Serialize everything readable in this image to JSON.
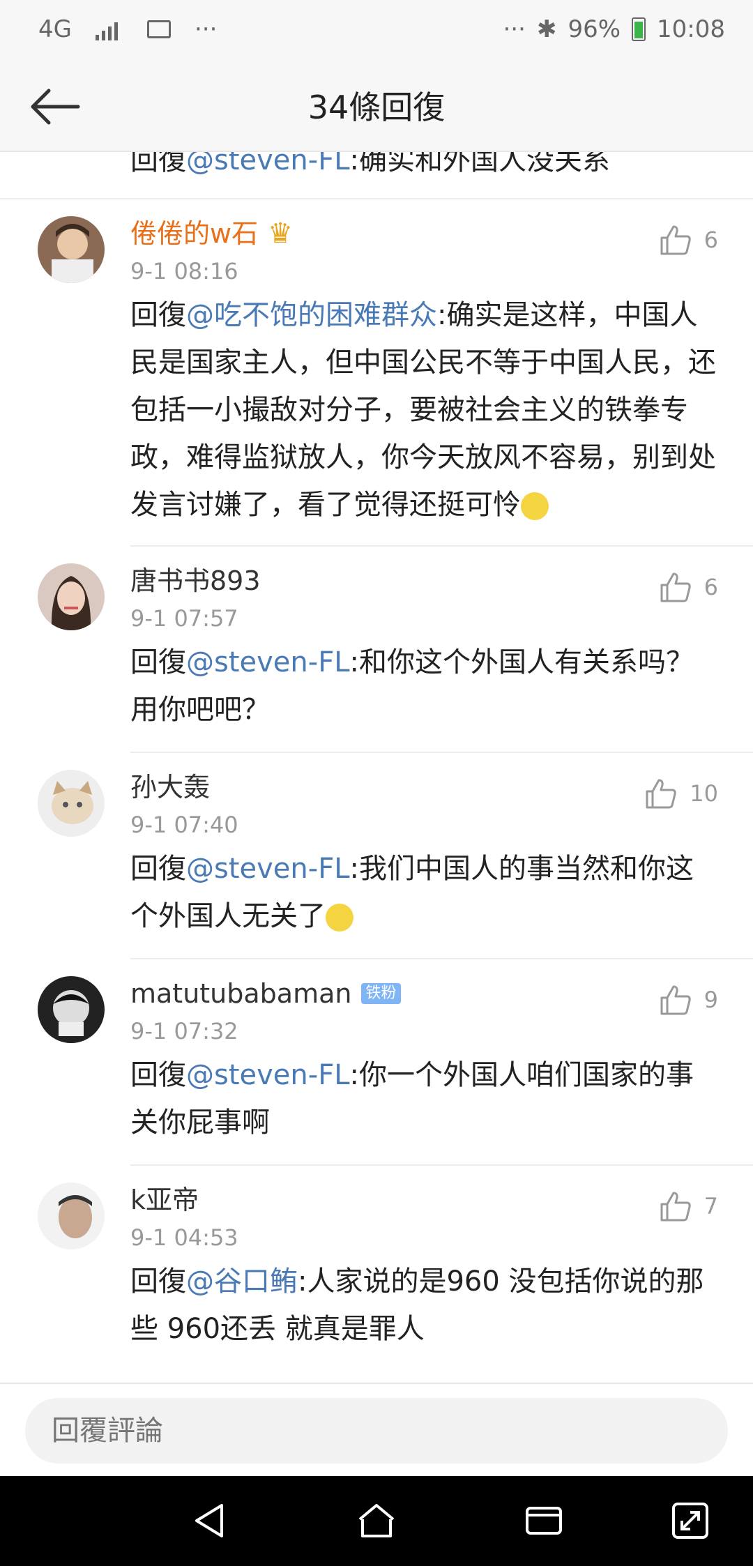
{
  "status_bar": {
    "network": "4G",
    "more_left": "···",
    "more_right": "···",
    "battery": "96%",
    "time": "10:08"
  },
  "header": {
    "title": "34條回復"
  },
  "partial": {
    "prefix": "回復",
    "mention": "@steven-FL",
    "text": ":确实和外国人没关系"
  },
  "comments": [
    {
      "name": "倦倦的w石",
      "time": "9-1 08:16",
      "likes": "6",
      "prefix": "回復",
      "mention": "@吃不饱的困难群众",
      "text": ":确实是这样，中国人民是国家主人，但中国公民不等于中国人民，还包括一小撮敌对分子，要被社会主义的铁拳专政，难得监狱放人，你今天放风不容易，别到处发言讨嫌了，看了觉得还挺可怜"
    },
    {
      "name": "唐书书893",
      "time": "9-1 07:57",
      "likes": "6",
      "prefix": "回復",
      "mention": "@steven-FL",
      "text": ":和你这个外国人有关系吗？用你吧吧？"
    },
    {
      "name": "孙大轰",
      "time": "9-1 07:40",
      "likes": "10",
      "prefix": "回復",
      "mention": "@steven-FL",
      "text": ":我们中国人的事当然和你这个外国人无关了"
    },
    {
      "name": "matutubabaman",
      "badge": "铁粉",
      "time": "9-1 07:32",
      "likes": "9",
      "prefix": "回復",
      "mention": "@steven-FL",
      "text": ":你一个外国人咱们国家的事关你屁事啊"
    },
    {
      "name": "k亚帝",
      "time": "9-1 04:53",
      "likes": "7",
      "prefix": "回復",
      "mention": "@谷口鲔",
      "text": ":人家说的是960 没包括你说的那些 960还丢 就真是罪人"
    }
  ],
  "reply": {
    "placeholder": "回覆評論"
  },
  "colors": {
    "mention": "#4a7ab5",
    "vip_name": "#e8701a",
    "time": "#999999"
  }
}
